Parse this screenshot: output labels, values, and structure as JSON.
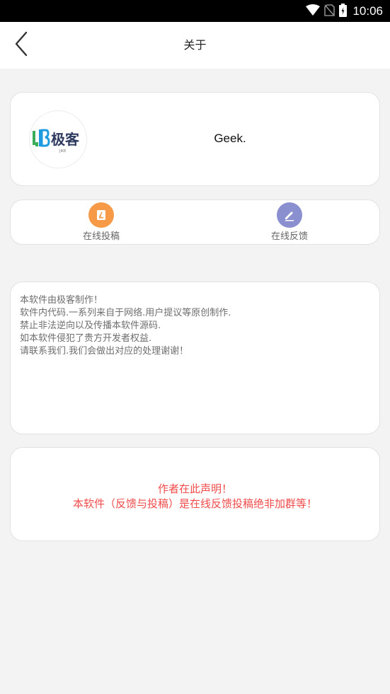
{
  "status_bar": {
    "time": "10:06",
    "icons": [
      "wifi-icon",
      "no-sim-icon",
      "battery-icon"
    ]
  },
  "header": {
    "title": "关于",
    "back_icon": "chevron-left-icon"
  },
  "profile": {
    "logo_text": "极客",
    "logo_subtext": "JIKE",
    "app_name": "Geek."
  },
  "actions": [
    {
      "label": "在线投稿",
      "icon": "submit-icon",
      "color": "#f79a47"
    },
    {
      "label": "在线反馈",
      "icon": "pencil-icon",
      "color": "#8a8fcf"
    }
  ],
  "info": {
    "lines": [
      "本软件由极客制作！",
      "软件内代码.一系列来自于网络.用户提议等原创制作.",
      "禁止非法逆向以及传播本软件源码.",
      "如本软件侵犯了贵方开发者权益.",
      "请联系我们.我们会做出对应的处理谢谢！"
    ]
  },
  "notice": {
    "lines": [
      "作者在此声明！",
      "本软件（反馈与投稿）是在线反馈投稿绝非加群等！"
    ],
    "color": "#ef4b4b"
  }
}
